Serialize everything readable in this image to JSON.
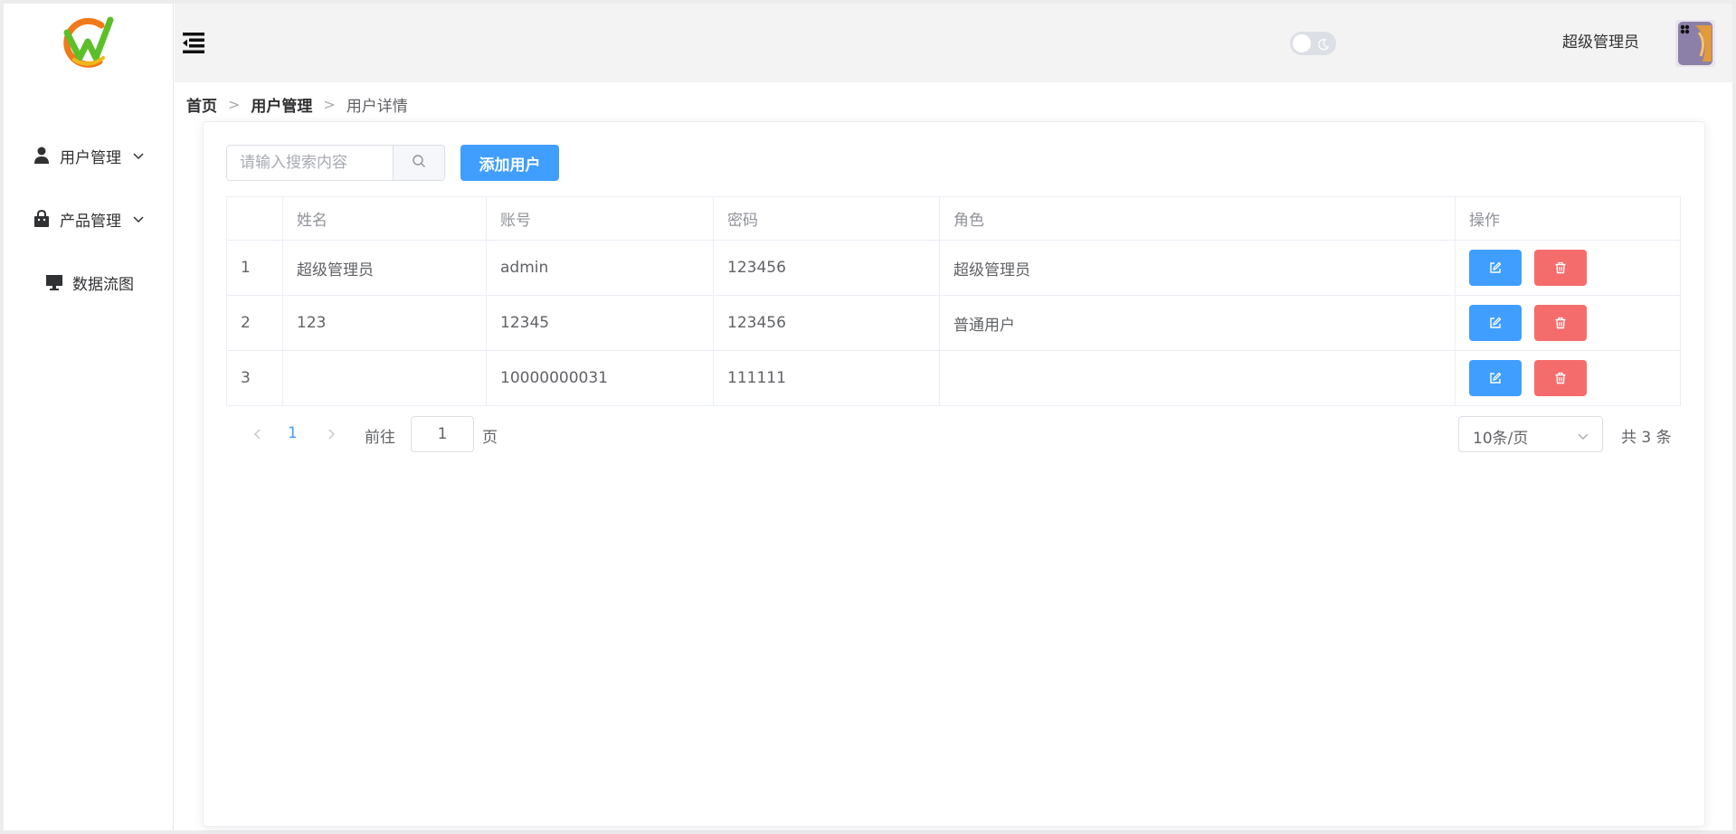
{
  "sidebar": {
    "items": [
      {
        "label": "用户管理",
        "icon": "user-icon",
        "has_arrow": true
      },
      {
        "label": "产品管理",
        "icon": "shopping-bag-icon",
        "has_arrow": true
      },
      {
        "label": "数据流图",
        "icon": "monitor-icon",
        "has_arrow": false
      }
    ]
  },
  "header": {
    "username": "超级管理员",
    "theme_toggle": "off"
  },
  "breadcrumb": [
    "首页",
    "用户管理",
    "用户详情"
  ],
  "breadcrumb_separator": ">",
  "toolbar": {
    "search_placeholder": "请输入搜索内容",
    "add_label": "添加用户"
  },
  "table": {
    "columns": [
      "",
      "姓名",
      "账号",
      "密码",
      "角色",
      "操作"
    ],
    "rows": [
      {
        "index": "1",
        "name": "超级管理员",
        "account": "admin",
        "password": "123456",
        "role": "超级管理员"
      },
      {
        "index": "2",
        "name": "123",
        "account": "12345",
        "password": "123456",
        "role": "普通用户"
      },
      {
        "index": "3",
        "name": "",
        "account": "10000000031",
        "password": "111111",
        "role": ""
      }
    ]
  },
  "pagination": {
    "current_page": "1",
    "goto_label": "前往",
    "goto_value": "1",
    "page_suffix": "页",
    "page_size": "10条/页",
    "total_label": "共 3 条"
  },
  "colors": {
    "primary": "#409eff",
    "danger": "#f56c6c",
    "header_bg": "#f3f3f3"
  }
}
